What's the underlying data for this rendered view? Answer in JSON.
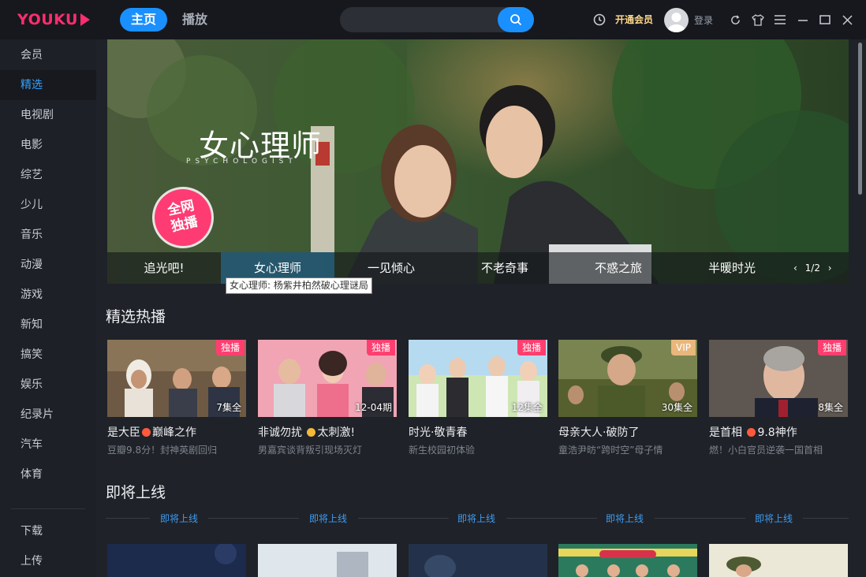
{
  "app": {
    "logo_text": "YOUKU",
    "nav": {
      "home": "主页",
      "play": "播放"
    },
    "search": {
      "placeholder": ""
    },
    "vip_label": "开通会员",
    "login_label": "登录",
    "accent_color": "#1a90ff",
    "brand_color": "#ff2d6f"
  },
  "sidebar": {
    "items": [
      {
        "label": "会员"
      },
      {
        "label": "精选",
        "active": true
      },
      {
        "label": "电视剧"
      },
      {
        "label": "电影"
      },
      {
        "label": "综艺"
      },
      {
        "label": "少儿"
      },
      {
        "label": "音乐"
      },
      {
        "label": "动漫"
      },
      {
        "label": "游戏"
      },
      {
        "label": "新知"
      },
      {
        "label": "搞笑"
      },
      {
        "label": "娱乐"
      },
      {
        "label": "纪录片"
      },
      {
        "label": "汽车"
      },
      {
        "label": "体育"
      }
    ],
    "bottom": [
      {
        "label": "下载"
      },
      {
        "label": "上传"
      }
    ]
  },
  "banner": {
    "title": "女心理师",
    "subtitle": "PSYCHOLOGIST",
    "badge_line1": "全网",
    "badge_line2": "独播",
    "tabs": [
      "追光吧!",
      "女心理师",
      "一见倾心",
      "不老奇事",
      "不惑之旅",
      "半暖时光"
    ],
    "active_index": 1,
    "pager": "1/2",
    "tooltip": "女心理师: 杨紫井柏然破心理谜局"
  },
  "hot": {
    "title": "精选热播",
    "cards": [
      {
        "badge": "独播",
        "badge_type": "exclusive",
        "eps": "7集全",
        "title_a": "是大臣",
        "title_b": "巅峰之作",
        "mark": "fire",
        "desc": "豆瓣9.8分！封神英剧回归"
      },
      {
        "badge": "独播",
        "badge_type": "exclusive",
        "eps": "12-04期",
        "title_a": "非诚勿扰",
        "title_b": "太刺激!",
        "mark": "shock",
        "desc": "男嘉宾谈背叛引现场灭灯"
      },
      {
        "badge": "独播",
        "badge_type": "exclusive",
        "eps": "12集全",
        "title_a": "时光·敬青春",
        "title_b": "",
        "mark": "",
        "desc": "新生校园初体验"
      },
      {
        "badge": "VIP",
        "badge_type": "vip",
        "eps": "30集全",
        "title_a": "母亲大人·破防了",
        "title_b": "",
        "mark": "",
        "desc": "童浩尹昉“跨时空”母子情"
      },
      {
        "badge": "独播",
        "badge_type": "exclusive",
        "eps": "8集全",
        "title_a": "是首相",
        "title_b": "9.8神作",
        "mark": "fire",
        "desc": "燃！小白官员逆袭一国首相"
      }
    ]
  },
  "upcoming": {
    "title": "即将上线",
    "labels": [
      "即将上线",
      "即将上线",
      "即将上线",
      "即将上线",
      "即将上线"
    ]
  }
}
